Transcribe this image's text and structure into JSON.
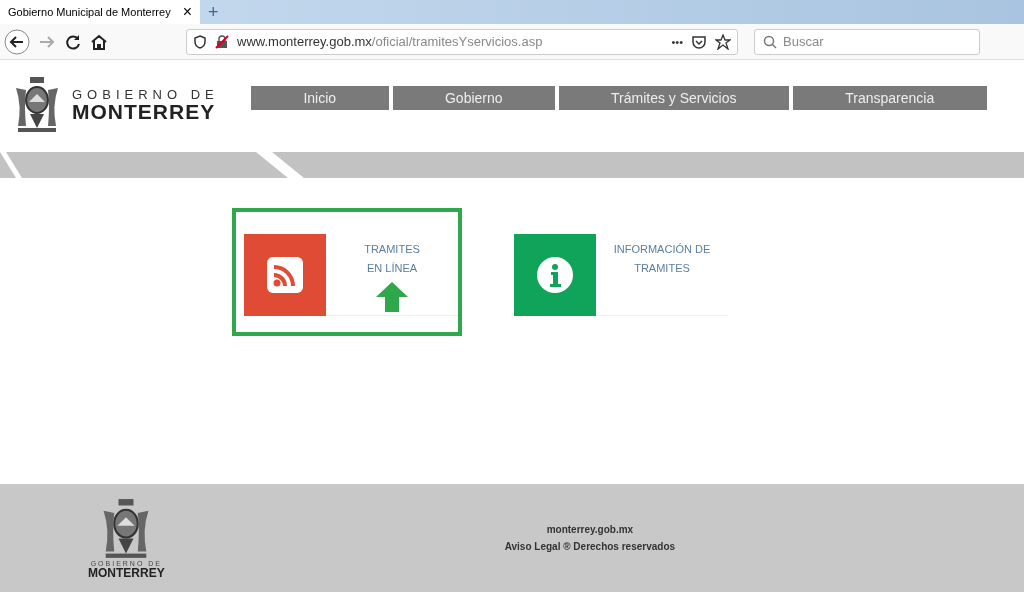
{
  "browser": {
    "tab_title": "Gobierno Municipal de Monterrey",
    "tab_close": "×",
    "new_tab": "+",
    "url_host": "www.monterrey.gob.mx",
    "url_path": "/oficial/tramitesYservicios.asp",
    "more": "•••",
    "search_placeholder": "Buscar"
  },
  "header": {
    "logo_top": "GOBIERNO DE",
    "logo_main": "MONTERREY",
    "nav": [
      {
        "label": "Inicio"
      },
      {
        "label": "Gobierno"
      },
      {
        "label": "Trámites y Servicios"
      },
      {
        "label": "Transparencia"
      }
    ]
  },
  "cards": [
    {
      "kind": "rss",
      "color": "#e04b35",
      "lines": [
        "TRAMITES",
        "EN LÍNEA"
      ],
      "selected": true,
      "arrow": true
    },
    {
      "kind": "info",
      "color": "#10a35a",
      "lines": [
        "INFORMACIÓN DE",
        "TRAMITES"
      ],
      "selected": false,
      "arrow": false
    }
  ],
  "footer": {
    "logo_top": "GOBIERNO DE",
    "logo_main": "MONTERREY",
    "site": "monterrey.gob.mx",
    "legal": "Aviso Legal ® Derechos reservados"
  }
}
